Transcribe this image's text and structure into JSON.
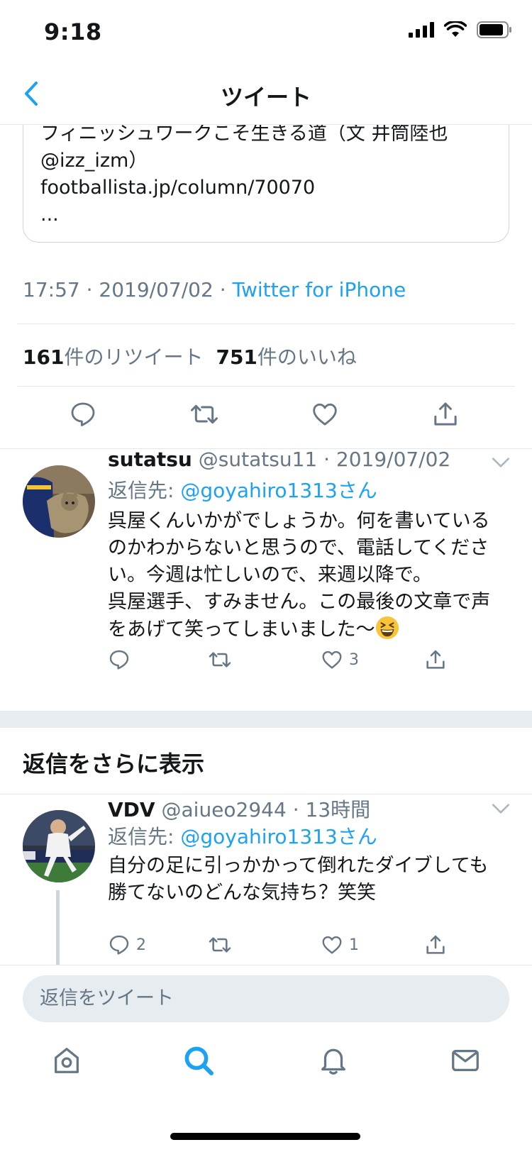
{
  "status_bar": {
    "time": "9:18"
  },
  "nav": {
    "title": "ツイート"
  },
  "quoted_card": {
    "lines": [
      "フィニッシュワークこそ生きる道（文 井筒陸也",
      "@izz_izm）",
      "footballista.jp/column/70070",
      "..."
    ]
  },
  "tweet_meta": {
    "time": "17:57",
    "date": "2019/07/02",
    "separator": "·",
    "source": "Twitter for iPhone"
  },
  "stats": {
    "retweets_count": "161",
    "retweets_label": "件のリツイート",
    "likes_count": "751",
    "likes_label": "件のいいね"
  },
  "replies": [
    {
      "name": "sutatsu",
      "handle": "@sutatsu11",
      "separator": "·",
      "date": "2019/07/02",
      "reply_to_label": "返信先: ",
      "reply_to_handle": "@goyahiro1313さん",
      "body_lines": [
        "呉屋くんいかがでしょうか。何を書いている",
        "のかわからないと思うので、電話してくださ",
        "い。今週は忙しいので、来週以降で。",
        "呉屋選手、すみません。この最後の文章で声",
        "をあげて笑ってしまいました〜"
      ],
      "emoji": "grinning-squinting-face",
      "reply_count": "",
      "retweet_count": "",
      "like_count": "3"
    },
    {
      "name": "VDV",
      "handle": "@aiueo2944",
      "separator": "·",
      "date": "13時間",
      "reply_to_label": "返信先: ",
      "reply_to_handle": "@goyahiro1313さん",
      "body_lines": [
        "自分の足に引っかかって倒れたダイブしても",
        "勝てないのどんな気持ち？笑笑"
      ],
      "reply_count": "2",
      "retweet_count": "",
      "like_count": "1"
    }
  ],
  "more_replies_label": "返信をさらに表示",
  "composer": {
    "placeholder": "返信をツイート"
  },
  "tabs": [
    "home-icon",
    "search-icon",
    "notifications-icon",
    "messages-icon"
  ],
  "colors": {
    "accent": "#1da1f2",
    "secondary_text": "#657786",
    "divider": "#e1e8ed",
    "band": "#e6ecf0"
  }
}
